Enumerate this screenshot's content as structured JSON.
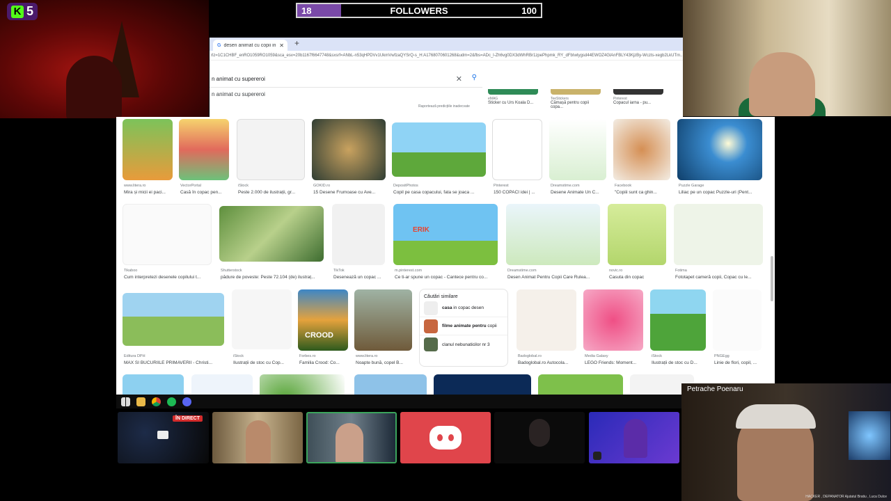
{
  "overlay": {
    "kick_count": "5",
    "followers": {
      "current": "18",
      "label": "FOLLOWERS",
      "goal": "100",
      "progress": 0.18
    }
  },
  "browser": {
    "tab_title": "desen animat cu copii in copac",
    "url": "rlz=1C1CHBF_enRO1059RO1059&sca_esv=20b1167f6647748&sxsrf=ANbL-n53qHPDVv1UkmVwfzaQYSrQ-s_H:A1768070601268&udm=2&fbs=ADc_l-Zh6vg0DX3dWhRBr1zpePhpmk_RY_dFbIwtygsd44EWOZ4GlAnFBLY43KjzBy-Wczts-xegb2LkUTm...",
    "search_text": "n animat cu supereroi",
    "suggestion": "n animat cu supereroi",
    "report": "Raportează predicțiile inadecvate",
    "top_results": [
      {
        "source": "eMAG",
        "caption": "Sticker cu Urs Koala D..."
      },
      {
        "source": "TeeStickers",
        "caption": "Cămașă pentru copii copa..."
      },
      {
        "source": "Pinterest",
        "caption": "Copacul iarna - pu..."
      }
    ]
  },
  "images": {
    "row1": [
      {
        "source": "www.litera.ro",
        "caption": "Mira și micii ei paci..."
      },
      {
        "source": "VectorPortal",
        "caption": "Casă în copac pen..."
      },
      {
        "source": "iStock",
        "caption": "Peste 2.000 de ilustrații, gr..."
      },
      {
        "source": "GOKID.ro",
        "caption": "15 Desene Frumoase cu Ave..."
      },
      {
        "source": "DepositPhotos",
        "caption": "Copil pe casa copacului, fata se joaca ..."
      },
      {
        "source": "Pinterest",
        "caption": "150 COPACI idei | ..."
      },
      {
        "source": "Dreamstime.com",
        "caption": "Desene Animate Un C..."
      },
      {
        "source": "Facebook",
        "caption": "\"Copiii sunt ca ghin..."
      },
      {
        "source": "Puzzle Garage",
        "caption": "Liliac pe un copac Puzzle-uri (Pent..."
      }
    ],
    "row2": [
      {
        "source": "Tikaboo",
        "caption": "Cum interpretezi desenele copilului t..."
      },
      {
        "source": "Shutterstock",
        "caption": "pădure de poveste: Peste 72.104 (de) ilustraț..."
      },
      {
        "source": "TikTok",
        "caption": "Desenează un copac ..."
      },
      {
        "source": "m.pinterest.com",
        "caption": "Ce ti-ar spune un copac - Cantece pentru co..."
      },
      {
        "source": "Dreamstime.com",
        "caption": "Desen Animat Pentru Copii Care Rulea..."
      },
      {
        "source": "novic.ro",
        "caption": "Casuta din copac"
      },
      {
        "source": "Fotima",
        "caption": "Fototapet cameră copii, Copac cu le..."
      }
    ],
    "row3": [
      {
        "source": "Editura DPH",
        "caption": "MAX SI BUCURIILE PRIMAVERII - Christi..."
      },
      {
        "source": "iStock",
        "caption": "Ilustrații de stoc cu Cop..."
      },
      {
        "source": "Forbes.ro",
        "caption": "Familia Crood: Co..."
      },
      {
        "source": "www.litera.ro",
        "caption": "Noapte bună, copel B..."
      },
      {
        "source": "Badoglobal.ro",
        "caption": "Badoglobal.ro Autocola..."
      },
      {
        "source": "Media Galaxy",
        "caption": "LEGO Friends: Moment..."
      },
      {
        "source": "iStock",
        "caption": "Ilustrații de stoc cu D..."
      },
      {
        "source": "PNGEgg",
        "caption": "Linie de flori, copil, ..."
      }
    ],
    "similar": {
      "title": "Căutări similare",
      "items": [
        {
          "bold": "casa",
          "rest": " in copac desen"
        },
        {
          "bold": "filme animate pentru",
          "rest": " copii"
        },
        {
          "bold": "",
          "rest": "clanul nebunaticilor nr 3"
        }
      ]
    },
    "thumb_texts": {
      "crood": "CROOD",
      "ariel": "ERIK"
    }
  },
  "call": {
    "live_badge": "ÎN DIRECT",
    "speaker_name": "Petrache Poenaru",
    "speaker_footer": "HACKER , DEPANATOR Ajutatul Bratiu , Luca Dulce"
  },
  "colors": {
    "followers_fill": "#7a4aa8",
    "kick_green": "#53fc18",
    "discord_red": "#e0454b"
  }
}
